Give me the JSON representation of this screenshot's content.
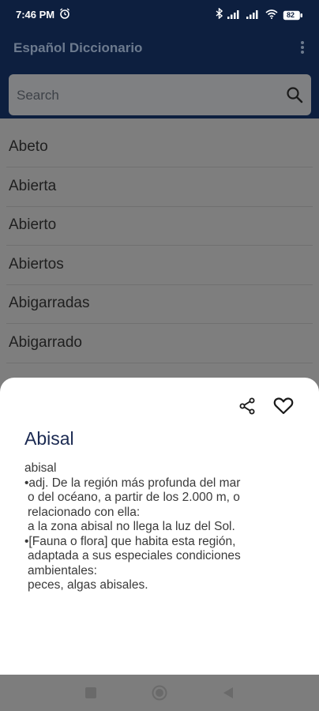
{
  "status": {
    "time": "7:46 PM",
    "battery": "82"
  },
  "app": {
    "title": "Español Diccionario"
  },
  "search": {
    "placeholder": "Search"
  },
  "words": [
    "Abeto",
    "Abierta",
    "Abierto",
    "Abiertos",
    "Abigarradas",
    "Abigarrado"
  ],
  "sheet": {
    "word": "Abisal",
    "lines": [
      "abisal",
      "•adj. De la región más profunda del mar",
      " o del océano, a partir de los 2.000 m, o",
      " relacionado con ella:",
      " a la zona abisal no llega la luz del Sol.",
      "•[Fauna o flora] que habita esta región,",
      " adaptada a sus especiales condiciones",
      " ambientales:",
      " peces, algas abisales."
    ]
  },
  "icons": {
    "alarm": "alarm-clock-icon",
    "bluetooth": "bluetooth-icon",
    "signal": "signal-icon",
    "wifi": "wifi-icon",
    "battery": "battery-icon",
    "menu": "more-vert-icon",
    "search": "search-icon",
    "share": "share-icon",
    "favorite": "heart-outline-icon",
    "nav_square": "recent-apps-icon",
    "nav_home": "home-icon",
    "nav_back": "back-icon"
  },
  "colors": {
    "appbar": "#0d1f3f",
    "word": "#1b2a52",
    "overlay": "#7e7e7e"
  }
}
